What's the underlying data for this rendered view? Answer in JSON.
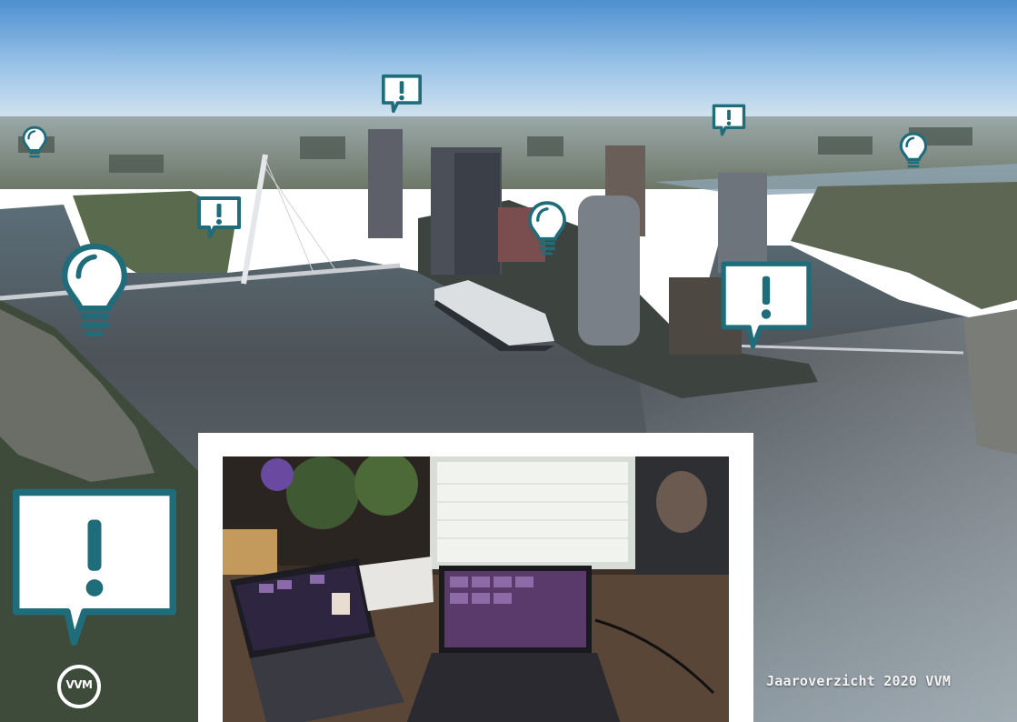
{
  "footer": {
    "caption": "Jaaroverzicht 2020 VVM",
    "logo_text": "VVM"
  },
  "colors": {
    "icon_teal": "#1f6c7a",
    "icon_fill": "#ffffff",
    "frame": "#ffffff"
  },
  "icons": [
    "lightbulb-icon",
    "exclamation-speech-bubble-icon"
  ]
}
